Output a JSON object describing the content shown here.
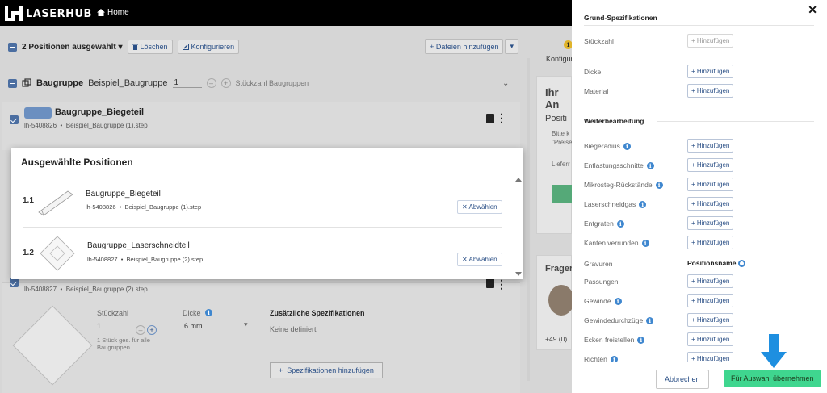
{
  "brand": {
    "logo_text": "LASERHUB"
  },
  "nav": {
    "home_label": "Home"
  },
  "toolbar": {
    "selection_label": "2 Positionen ausgewählt",
    "delete_label": "Löschen",
    "configure_label": "Konfigurieren",
    "add_files_label": "+ Dateien hinzufügen"
  },
  "group": {
    "prefix": "Baugruppe",
    "name": "Beispiel_Baugruppe",
    "quantity": "1",
    "quantity_label": "Stückzahl Baugruppen"
  },
  "part1": {
    "title": "Baugruppe_Biegeteil",
    "id": "lh-5408826",
    "file": "Beispiel_Baugruppe (1).step"
  },
  "part2": {
    "id": "lh-5408827",
    "file": "Beispiel_Baugruppe (2).step",
    "qty_label": "Stückzahl",
    "qty_value": "1",
    "qty_hint": "1 Stück ges. für alle Baugruppen",
    "thickness_label": "Dicke",
    "thickness_value": "6 mm",
    "extra_title": "Zusätzliche Spezifikationen",
    "extra_none": "Keine definiert",
    "extra_add": "Spezifikationen hinzufügen"
  },
  "sidebar_bg": {
    "badge": "1",
    "konfig": "Konfigur",
    "ihr_an": "Ihr An",
    "positi": "Positi",
    "bitte": "Bitte k",
    "preise": "\"Preise",
    "liefer": "Lieferr",
    "fragen": "Frager",
    "phone": "+49 (0)"
  },
  "modal": {
    "title": "Ausgewählte Positionen",
    "rows": [
      {
        "num": "1.1",
        "name": "Baugruppe_Biegeteil",
        "id": "lh-5408826",
        "file": "Beispiel_Baugruppe (1).step",
        "button": "Abwählen"
      },
      {
        "num": "1.2",
        "name": "Baugruppe_Laserschneidteil",
        "id": "lh-5408827",
        "file": "Beispiel_Baugruppe (2).step",
        "button": "Abwählen"
      }
    ]
  },
  "panel": {
    "close": "✕",
    "basic_title": "Grund-Spezifikationen",
    "basic": [
      {
        "label": "Stückzahl",
        "button": "+ Hinzufügen",
        "info": false,
        "disabled": true
      },
      {
        "label": "Dicke",
        "button": "+ Hinzufügen",
        "info": false,
        "disabled": false
      },
      {
        "label": "Material",
        "button": "+ Hinzufügen",
        "info": false,
        "disabled": false
      }
    ],
    "processing_title": "Weiterbearbeitung",
    "processing": [
      {
        "label": "Biegeradius",
        "button": "+ Hinzufügen",
        "info": true
      },
      {
        "label": "Entlastungsschnitte",
        "button": "+ Hinzufügen",
        "info": true
      },
      {
        "label": "Mikrosteg-Rückstände",
        "button": "+ Hinzufügen",
        "info": true
      },
      {
        "label": "Laserschneidgas",
        "button": "+ Hinzufügen",
        "info": true
      },
      {
        "label": "Entgraten",
        "button": "+ Hinzufügen",
        "info": true
      },
      {
        "label": "Kanten verrunden",
        "button": "+ Hinzufügen",
        "info": true
      },
      {
        "label": "Gravuren",
        "button": "Positionsname",
        "info": false
      },
      {
        "label": "Passungen",
        "button": "+ Hinzufügen",
        "info": false
      },
      {
        "label": "Gewinde",
        "button": "+ Hinzufügen",
        "info": true
      },
      {
        "label": "Gewindedurchzüge",
        "button": "+ Hinzufügen",
        "info": true
      },
      {
        "label": "Ecken freistellen",
        "button": "+ Hinzufügen",
        "info": true
      },
      {
        "label": "Richten",
        "button": "+ Hinzufügen",
        "info": true
      }
    ],
    "cancel_label": "Abbrechen",
    "apply_label": "Für Auswahl übernehmen"
  },
  "colors": {
    "accent": "#3fd68f",
    "link": "#2a4f86",
    "info": "#3f87cf",
    "arrow": "#1e8fe0"
  }
}
